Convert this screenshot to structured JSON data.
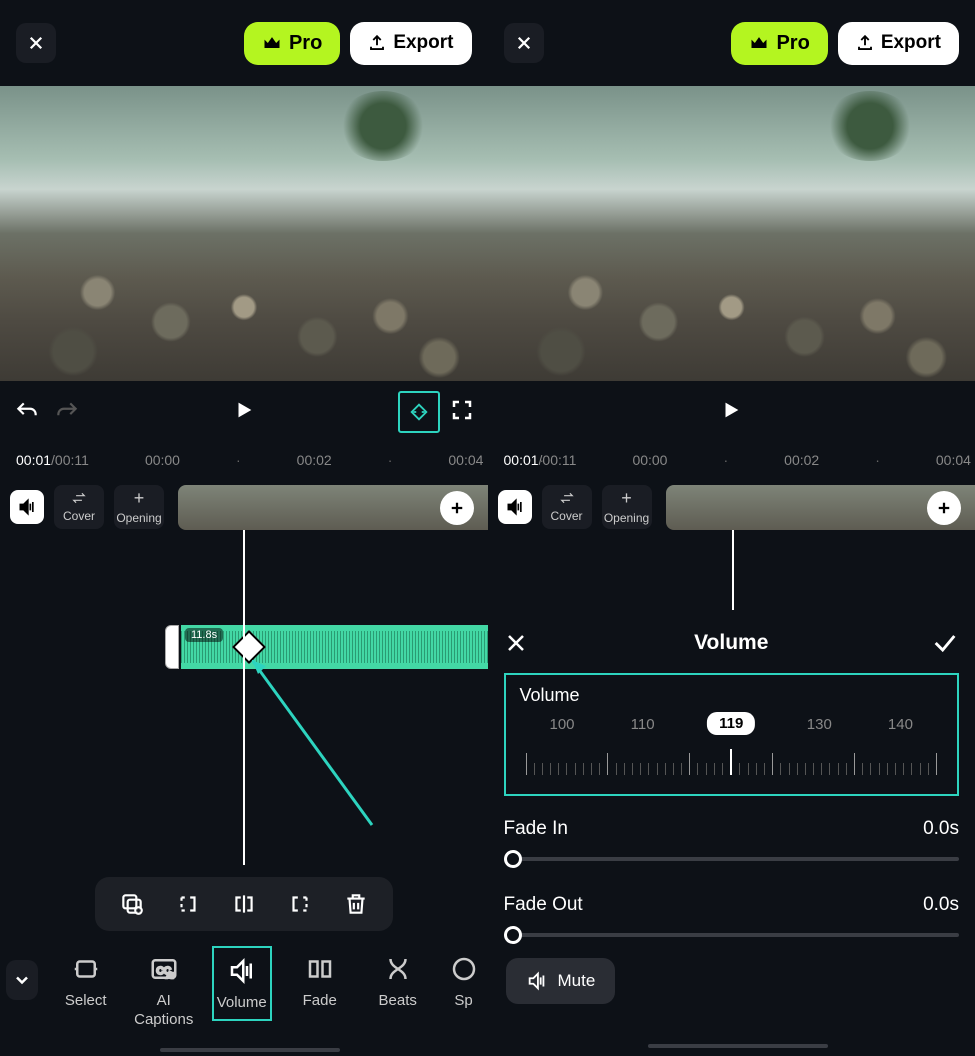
{
  "topbar": {
    "pro_label": "Pro",
    "export_label": "Export"
  },
  "time": {
    "left_current": "00:01",
    "left_total": "/00:11",
    "marks": [
      "00:00",
      "00:02",
      "00:04"
    ]
  },
  "track": {
    "cover_label": "Cover",
    "opening_label": "Opening",
    "clip_duration": "11.8s"
  },
  "toolbar": {
    "select": "Select",
    "ai_captions_1": "AI",
    "ai_captions_2": "Captions",
    "volume": "Volume",
    "fade": "Fade",
    "beats": "Beats",
    "split_partial": "Sp"
  },
  "volume_panel": {
    "title": "Volume",
    "label": "Volume",
    "ticks": [
      "100",
      "110",
      "",
      "130",
      "140"
    ],
    "current": "119",
    "fade_in_label": "Fade In",
    "fade_in_value": "0.0s",
    "fade_out_label": "Fade Out",
    "fade_out_value": "0.0s",
    "mute_label": "Mute"
  }
}
